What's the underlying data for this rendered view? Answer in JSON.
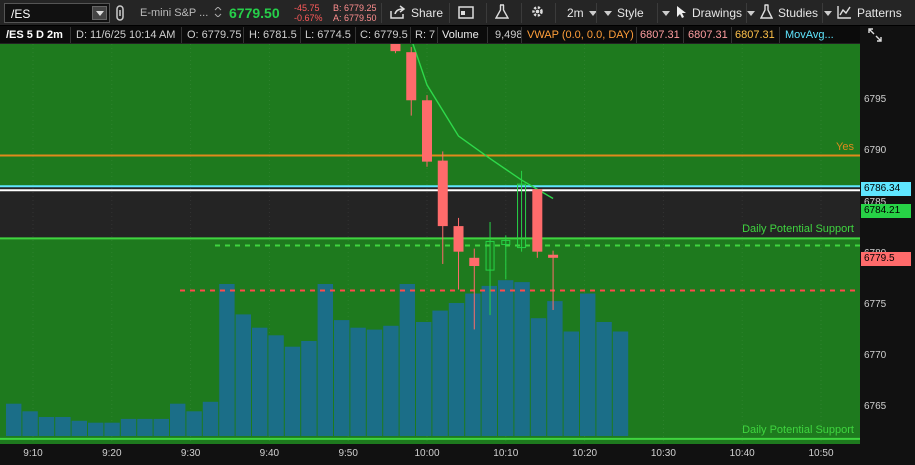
{
  "toolbar": {
    "symbol": "/ES",
    "description": "E-mini S&P ...",
    "last_price": "6779.50",
    "net_change": "-45.75",
    "net_change_pct": "-0.67%",
    "bid": "B: 6779.25",
    "ask": "A: 6779.50",
    "share_label": "Share",
    "timeframe_label": "2m",
    "style_label": "Style",
    "drawings_label": "Drawings",
    "studies_label": "Studies",
    "patterns_label": "Patterns",
    "icons": [
      "chevron-down-icon",
      "link-icon",
      "share-icon",
      "calendar-icon",
      "flask-icon",
      "gear-icon",
      "pointer-icon",
      "studies-flask-icon",
      "patterns-icon"
    ]
  },
  "infobar": {
    "title": "/ES 5 D 2m",
    "datetime": "D: 11/6/25 10:14 AM",
    "open": "O: 6779.75",
    "high": "H: 6781.5",
    "low": "L: 6774.5",
    "close": "C: 6779.5",
    "range": "R: 7",
    "volume_label": "Volume",
    "volume_value": "9,498",
    "vwap_label": "VWAP (0.0, 0.0, DAY)",
    "vwap_values": [
      "6807.31",
      "6807.31",
      "6807.31"
    ],
    "movavg_label": "MovAvg..."
  },
  "colors": {
    "up": "#27d246",
    "down": "#ff6b6b",
    "volume": "#1b6e88",
    "zone_green": "#1e7a1e",
    "zone_dark": "#242424",
    "yes_line": "#e08a1c",
    "support_text": "#3fd43f"
  },
  "chart_data": {
    "type": "candlestick",
    "time_ticks": [
      "9:10",
      "9:20",
      "9:30",
      "9:40",
      "9:50",
      "10:00",
      "10:10",
      "10:20",
      "10:30",
      "10:40",
      "10:50"
    ],
    "price_ticks": [
      "6795",
      "6790",
      "6785",
      "6780",
      "6775",
      "6770",
      "6765"
    ],
    "price_range": [
      6761.4,
      6800.5
    ],
    "price_labels": [
      {
        "value": 6786.34,
        "text": "6786.34",
        "color": "#5fe6ff"
      },
      {
        "value": 6784.21,
        "text": "6784.21",
        "color": "#27d246"
      },
      {
        "value": 6779.5,
        "text": "6779.5",
        "color": "#ff6b6b"
      }
    ],
    "lines": [
      {
        "name": "Yes",
        "price": 6789.6,
        "color": "#e08a1c",
        "style": "solid"
      },
      {
        "name": "Daily Potential Support",
        "price": 6781.5,
        "color": "#3fd43f",
        "style": "solid"
      },
      {
        "name": "",
        "price": 6780.8,
        "color": "#3fd43f",
        "style": "dashed"
      },
      {
        "name": "",
        "price": 6776.4,
        "color": "#ff4a4a",
        "style": "dashed"
      },
      {
        "name": "Daily Potential Support",
        "price": 6761.9,
        "color": "#3fd43f",
        "style": "solid"
      },
      {
        "name": "",
        "price": 6786.6,
        "color": "#5fe6ff",
        "style": "solid"
      },
      {
        "name": "",
        "price": 6786.2,
        "color": "#ffffff",
        "style": "solid"
      }
    ],
    "candles": [
      {
        "time": "9:56",
        "open": 6800.5,
        "high": 6801.5,
        "low": 6799.6,
        "close": 6799.8
      },
      {
        "time": "9:58",
        "open": 6799.7,
        "high": 6800.2,
        "low": 6793.5,
        "close": 6795.0
      },
      {
        "time": "10:00",
        "open": 6795.0,
        "high": 6795.5,
        "low": 6788.5,
        "close": 6789.0
      },
      {
        "time": "10:02",
        "open": 6789.1,
        "high": 6790.0,
        "low": 6779.0,
        "close": 6782.7
      },
      {
        "time": "10:04",
        "open": 6782.7,
        "high": 6783.5,
        "low": 6776.5,
        "close": 6780.2
      },
      {
        "time": "10:06",
        "open": 6779.6,
        "high": 6780.5,
        "low": 6772.6,
        "close": 6778.8
      },
      {
        "time": "10:08",
        "open": 6778.4,
        "high": 6783.1,
        "low": 6774.0,
        "close": 6781.2
      },
      {
        "time": "10:10",
        "open": 6780.9,
        "high": 6781.8,
        "low": 6777.5,
        "close": 6781.3
      },
      {
        "time": "10:12",
        "open": 6780.6,
        "high": 6788.1,
        "low": 6780.2,
        "close": 6786.8
      },
      {
        "time": "10:14",
        "open": 6786.3,
        "high": 6786.3,
        "low": 6779.6,
        "close": 6780.2
      },
      {
        "time": "10:16",
        "open": 6779.9,
        "high": 6780.3,
        "low": 6774.5,
        "close": 6779.6
      }
    ],
    "moving_average": [
      {
        "time": "9:58",
        "value": 6801.0
      },
      {
        "time": "10:00",
        "value": 6796.5
      },
      {
        "time": "10:04",
        "value": 6791.5
      },
      {
        "time": "10:08",
        "value": 6789.3
      },
      {
        "time": "10:12",
        "value": 6787.2
      },
      {
        "time": "10:16",
        "value": 6785.4
      }
    ],
    "volume_bars": [
      0.17,
      0.13,
      0.1,
      0.1,
      0.08,
      0.07,
      0.07,
      0.09,
      0.09,
      0.09,
      0.17,
      0.13,
      0.18,
      0.8,
      0.64,
      0.57,
      0.53,
      0.47,
      0.5,
      0.8,
      0.61,
      0.57,
      0.56,
      0.58,
      0.8,
      0.6,
      0.66,
      0.7,
      0.75,
      0.79,
      0.82,
      0.81,
      0.62,
      0.71,
      0.55,
      0.75,
      0.6,
      0.55
    ]
  }
}
